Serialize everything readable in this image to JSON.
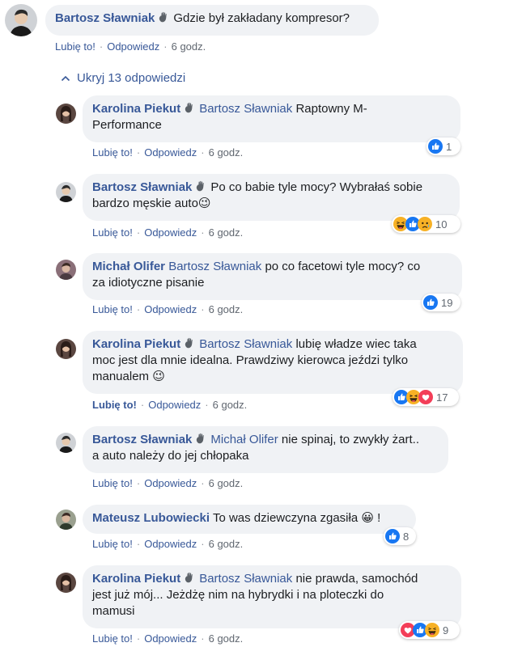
{
  "top_comment": {
    "author": "Bartosz Sławniak",
    "text": "Gdzie był zakładany kompresor?",
    "like": "Lubię to!",
    "reply": "Odpowiedz",
    "time": "6 godz."
  },
  "hide_replies": "Ukryj 13 odpowiedzi",
  "replies": [
    {
      "author": "Karolina Piekut",
      "mention": "Bartosz Sławniak",
      "text_l1": "Raptowny M-",
      "text_l2": "Performance",
      "like": "Lubię to!",
      "reply": "Odpowiedz",
      "time": "6 godz.",
      "reactions": [
        "like"
      ],
      "count": "1"
    },
    {
      "author": "Bartosz Sławniak",
      "text_l1": "Po co babie tyle mocy? Wybrałaś sobie",
      "text_l2": "bardzo męskie auto",
      "emoji": "😉",
      "like": "Lubię to!",
      "reply": "Odpowiedz",
      "time": "6 godz.",
      "reactions": [
        "haha",
        "like",
        "sad"
      ],
      "count": "10"
    },
    {
      "author": "Michał Olifer",
      "mention": "Bartosz Sławniak",
      "text_l1": "po co facetowi tyle mocy? co",
      "text_l2": "za idiotyczne pisanie",
      "like": "Lubię to!",
      "reply": "Odpowiedz",
      "time": "6 godz.",
      "reactions": [
        "like"
      ],
      "count": "19"
    },
    {
      "author": "Karolina Piekut",
      "mention": "Bartosz Sławniak",
      "text_l1": "lubię władze wiec taka",
      "text_l2": "moc jest dla mnie idealna. Prawdziwy kierowca jeździ tylko",
      "text_l3": "manualem",
      "emoji": "😉",
      "like": "Lubię to!",
      "reply": "Odpowiedz",
      "time": "6 godz.",
      "reactions": [
        "like",
        "haha",
        "love"
      ],
      "count": "17"
    },
    {
      "author": "Bartosz Sławniak",
      "mention": "Michał Olifer",
      "text_l1": "nie spinaj, to zwykły żart..",
      "text_l2": "a auto należy do jej chłopaka",
      "like": "Lubię to!",
      "reply": "Odpowiedz",
      "time": "6 godz."
    },
    {
      "author": "Mateusz Lubowiecki",
      "text_l1": "To was dziewczyna zgasiła",
      "emoji": "😀",
      "text_after": "!",
      "like": "Lubię to!",
      "reply": "Odpowiedz",
      "time": "6 godz.",
      "reactions": [
        "like"
      ],
      "count": "8"
    },
    {
      "author": "Karolina Piekut",
      "mention": "Bartosz Sławniak",
      "text_l1": "nie prawda, samochód",
      "text_l2": "jest już mój... Jeżdżę nim na hybrydki i na ploteczki do",
      "text_l3": "mamusi",
      "like": "Lubię to!",
      "reply": "Odpowiedz",
      "time": "6 godz.",
      "reactions": [
        "love",
        "like",
        "haha"
      ],
      "count": "9"
    }
  ],
  "colors": {
    "link": "#385898",
    "bubble": "#f0f2f5",
    "like_blue": "#1877f2",
    "love_red": "#f33e58",
    "haha_yellow": "#f7b125"
  }
}
